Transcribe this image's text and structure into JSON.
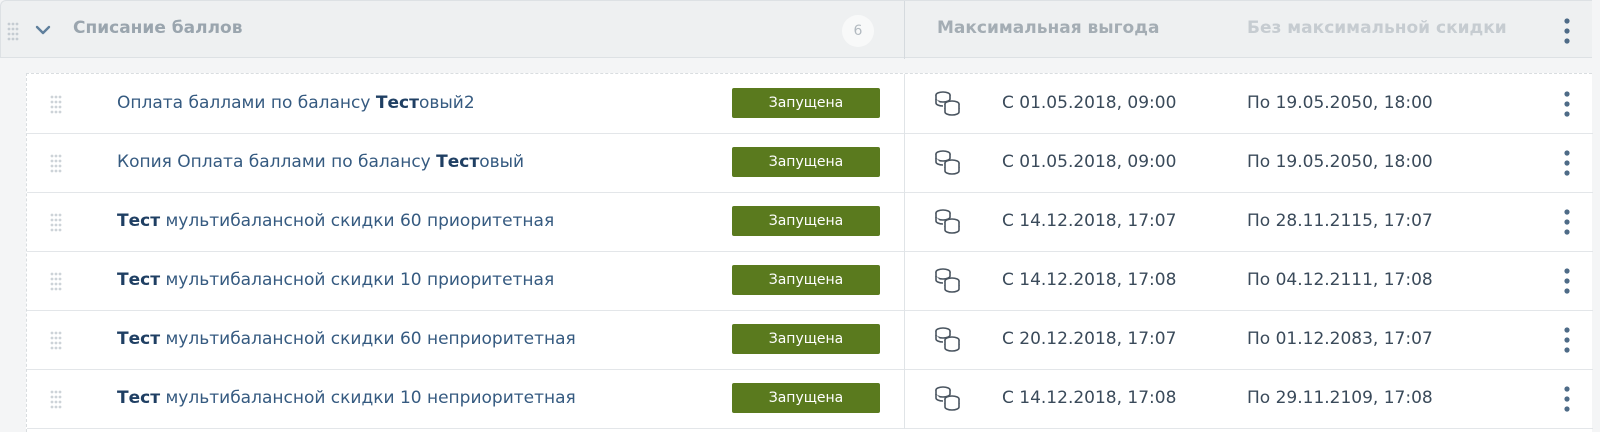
{
  "header": {
    "title": "Списание баллов",
    "count": "6",
    "col_max_benefit": "Максимальная выгода",
    "col_no_max_discount": "Без максимальной скидки"
  },
  "status_color": "#5a7a1e",
  "rows": [
    {
      "name_plain_before": "Оплата баллами по балансу ",
      "name_bold": "Тест",
      "name_plain_after": "овый2",
      "status": "Запущена",
      "start": "С 01.05.2018, 09:00",
      "end": "По 19.05.2050, 18:00",
      "icon": "coins-icon"
    },
    {
      "name_plain_before": "Копия Оплата баллами по балансу ",
      "name_bold": "Тест",
      "name_plain_after": "овый",
      "status": "Запущена",
      "start": "С 01.05.2018, 09:00",
      "end": "По 19.05.2050, 18:00",
      "icon": "coins-icon"
    },
    {
      "name_plain_before": "",
      "name_bold": "Тест",
      "name_plain_after": " мультибалансной скидки 60 приоритетная",
      "status": "Запущена",
      "start": "С 14.12.2018, 17:07",
      "end": "По 28.11.2115, 17:07",
      "icon": "coins-icon"
    },
    {
      "name_plain_before": "",
      "name_bold": "Тест",
      "name_plain_after": " мультибалансной скидки 10 приоритетная",
      "status": "Запущена",
      "start": "С 14.12.2018, 17:08",
      "end": "По 04.12.2111, 17:08",
      "icon": "coins-icon"
    },
    {
      "name_plain_before": "",
      "name_bold": "Тест",
      "name_plain_after": " мультибалансной скидки 60 неприоритетная",
      "status": "Запущена",
      "start": "С 20.12.2018, 17:07",
      "end": "По 01.12.2083, 17:07",
      "icon": "coins-icon"
    },
    {
      "name_plain_before": "",
      "name_bold": "Тест",
      "name_plain_after": " мультибалансной скидки 10 неприоритетная",
      "status": "Запущена",
      "start": "С 14.12.2018, 17:08",
      "end": "По 29.11.2109, 17:08",
      "icon": "coins-icon"
    }
  ]
}
